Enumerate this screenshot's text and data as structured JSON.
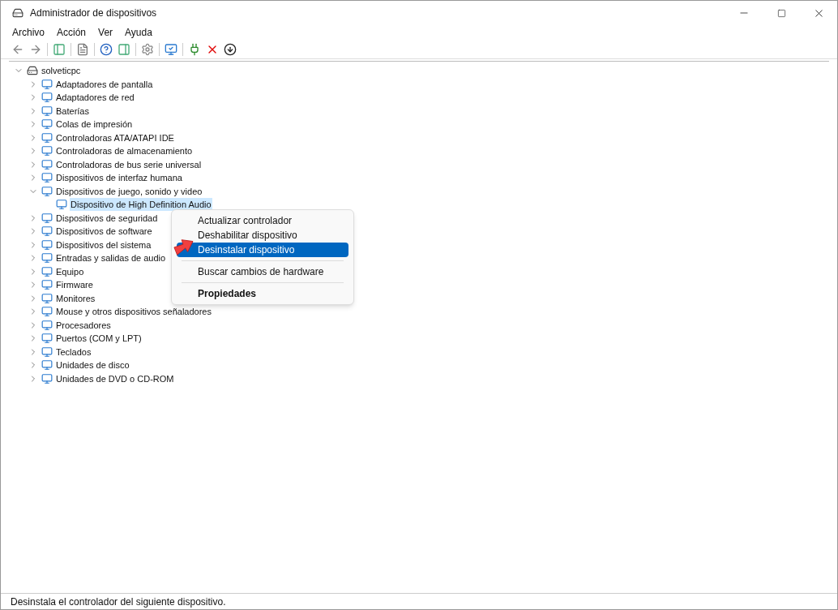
{
  "window": {
    "title": "Administrador de dispositivos"
  },
  "menu_bar": [
    "Archivo",
    "Acción",
    "Ver",
    "Ayuda"
  ],
  "tree": {
    "label": "solveticpc",
    "expanded": true,
    "children": [
      {
        "label": "Adaptadores de pantalla",
        "expanded": false
      },
      {
        "label": "Adaptadores de red",
        "expanded": false
      },
      {
        "label": "Baterías",
        "expanded": false
      },
      {
        "label": "Colas de impresión",
        "expanded": false
      },
      {
        "label": "Controladoras ATA/ATAPI IDE",
        "expanded": false
      },
      {
        "label": "Controladoras de almacenamiento",
        "expanded": false
      },
      {
        "label": "Controladoras de bus serie universal",
        "expanded": false
      },
      {
        "label": "Dispositivos de interfaz humana",
        "expanded": false
      },
      {
        "label": "Dispositivos de juego, sonido y video",
        "expanded": true,
        "children": [
          {
            "label": "Dispositivo de High Definition Audio",
            "selected": true
          }
        ]
      },
      {
        "label": "Dispositivos de seguridad",
        "expanded": false
      },
      {
        "label": "Dispositivos de software",
        "expanded": false
      },
      {
        "label": "Dispositivos del sistema",
        "expanded": false
      },
      {
        "label": "Entradas y salidas de audio",
        "expanded": false
      },
      {
        "label": "Equipo",
        "expanded": false
      },
      {
        "label": "Firmware",
        "expanded": false
      },
      {
        "label": "Monitores",
        "expanded": false
      },
      {
        "label": "Mouse y otros dispositivos señaladores",
        "expanded": false
      },
      {
        "label": "Procesadores",
        "expanded": false
      },
      {
        "label": "Puertos (COM y LPT)",
        "expanded": false
      },
      {
        "label": "Teclados",
        "expanded": false
      },
      {
        "label": "Unidades de disco",
        "expanded": false
      },
      {
        "label": "Unidades de DVD o CD-ROM",
        "expanded": false
      }
    ]
  },
  "context_menu": [
    {
      "label": "Actualizar controlador",
      "selected": false,
      "default": false,
      "separator_before": false
    },
    {
      "label": "Deshabilitar dispositivo",
      "selected": false,
      "default": false,
      "separator_before": false
    },
    {
      "label": "Desinstalar dispositivo",
      "selected": true,
      "default": false,
      "separator_before": false
    },
    {
      "label": "Buscar cambios de hardware",
      "selected": false,
      "default": false,
      "separator_before": true
    },
    {
      "label": "Propiedades",
      "selected": false,
      "default": true,
      "separator_before": true
    }
  ],
  "status_bar": "Desinstala el controlador del siguiente dispositivo."
}
